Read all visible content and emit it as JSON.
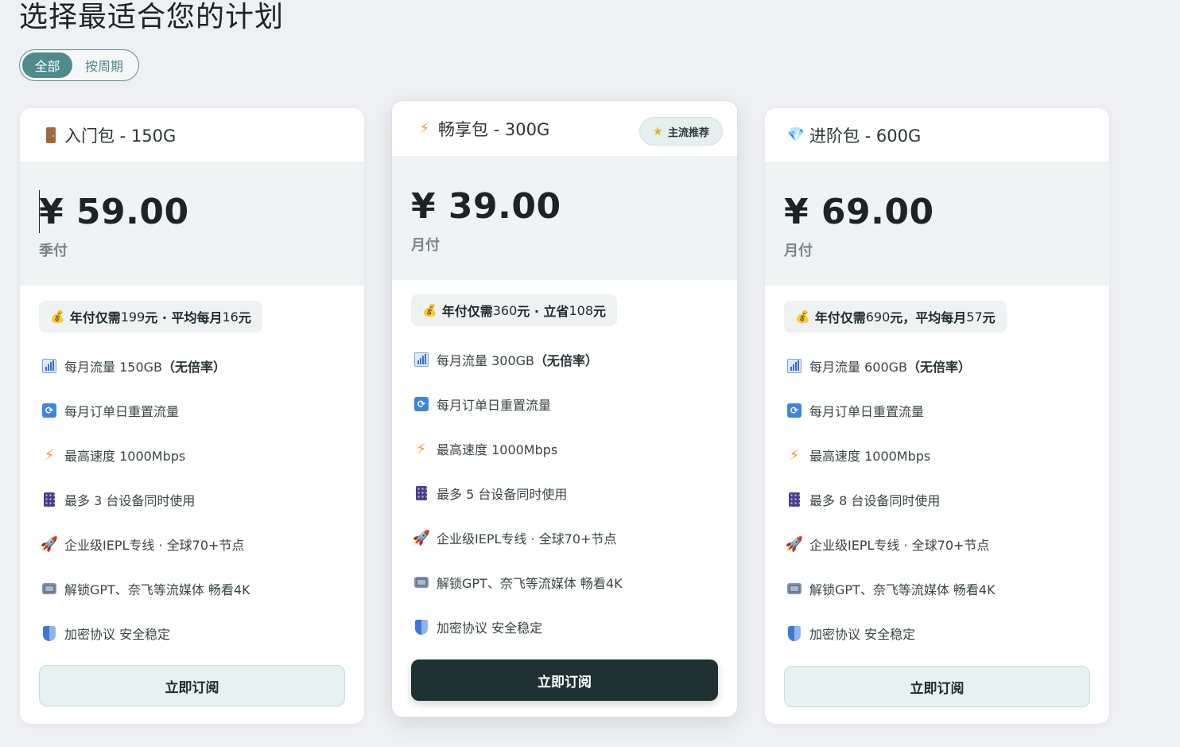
{
  "page": {
    "title": "选择最适合您的计划"
  },
  "filter": {
    "options": [
      "全部",
      "按周期"
    ],
    "selected": "全部"
  },
  "colors": {
    "accent": "#4f8a8c",
    "dark_button": "#1f3133",
    "light_button": "#e7f1f1",
    "price_bg": "#eff3f4"
  },
  "plans": [
    {
      "icon": "door-icon",
      "name": "入门包 - 150G",
      "badge": null,
      "price": "¥ 59.00",
      "period": "季付",
      "promo": {
        "a": "年付仅需",
        "b": " 199 ",
        "c": "元 · 平均每月",
        "d": " 16 ",
        "e": "元"
      },
      "features": [
        {
          "icon": "bar-chart-icon",
          "pre": "每月流量 150GB",
          "bold": "（无倍率）"
        },
        {
          "icon": "sync-icon",
          "pre": "每月订单日重置流量",
          "bold": ""
        },
        {
          "icon": "lightning-icon",
          "pre": "最高速度 1000Mbps",
          "bold": ""
        },
        {
          "icon": "devices-icon",
          "pre": "最多 3 台设备同时使用",
          "bold": ""
        },
        {
          "icon": "rocket-icon",
          "pre": "企业级IEPL专线 · 全球70+节点",
          "bold": ""
        },
        {
          "icon": "tv-icon",
          "pre": "解锁GPT、奈飞等流媒体 畅看4K",
          "bold": ""
        },
        {
          "icon": "shield-icon",
          "pre": "加密协议 安全稳定",
          "bold": ""
        }
      ],
      "button": "立即订阅"
    },
    {
      "icon": "lightning-icon",
      "name": "畅享包 - 300G",
      "badge": "主流推荐",
      "price": "¥ 39.00",
      "period": "月付",
      "promo": {
        "a": "年付仅需",
        "b": " 360 ",
        "c": "元 · 立省",
        "d": " 108 ",
        "e": "元"
      },
      "features": [
        {
          "icon": "bar-chart-icon",
          "pre": "每月流量 300GB",
          "bold": "（无倍率）"
        },
        {
          "icon": "sync-icon",
          "pre": "每月订单日重置流量",
          "bold": ""
        },
        {
          "icon": "lightning-icon",
          "pre": "最高速度 1000Mbps",
          "bold": ""
        },
        {
          "icon": "devices-icon",
          "pre": "最多 5 台设备同时使用",
          "bold": ""
        },
        {
          "icon": "rocket-icon",
          "pre": "企业级IEPL专线 · 全球70+节点",
          "bold": ""
        },
        {
          "icon": "tv-icon",
          "pre": "解锁GPT、奈飞等流媒体 畅看4K",
          "bold": ""
        },
        {
          "icon": "shield-icon",
          "pre": "加密协议 安全稳定",
          "bold": ""
        }
      ],
      "button": "立即订阅"
    },
    {
      "icon": "gem-icon",
      "name": "进阶包 - 600G",
      "badge": null,
      "price": "¥ 69.00",
      "period": "月付",
      "promo": {
        "a": "年付仅需",
        "b": " 690",
        "c": "元，平均每月",
        "d": "57",
        "e": "元"
      },
      "features": [
        {
          "icon": "bar-chart-icon",
          "pre": "每月流量 600GB",
          "bold": "（无倍率）"
        },
        {
          "icon": "sync-icon",
          "pre": "每月订单日重置流量",
          "bold": ""
        },
        {
          "icon": "lightning-icon",
          "pre": "最高速度 1000Mbps",
          "bold": ""
        },
        {
          "icon": "devices-icon",
          "pre": "最多 8 台设备同时使用",
          "bold": ""
        },
        {
          "icon": "rocket-icon",
          "pre": "企业级IEPL专线 · 全球70+节点",
          "bold": ""
        },
        {
          "icon": "tv-icon",
          "pre": "解锁GPT、奈飞等流媒体 畅看4K",
          "bold": ""
        },
        {
          "icon": "shield-icon",
          "pre": "加密协议 安全稳定",
          "bold": ""
        }
      ],
      "button": "立即订阅"
    }
  ]
}
